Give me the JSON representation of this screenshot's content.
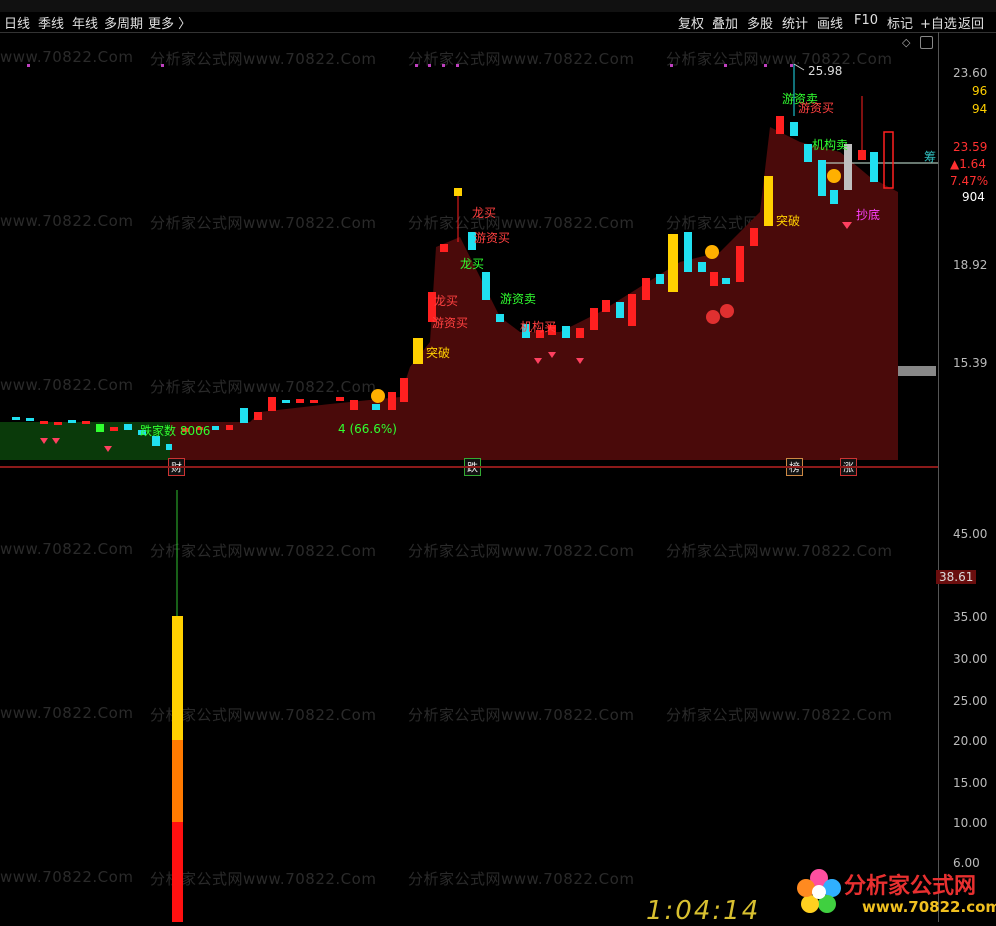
{
  "toolbar_left": [
    "日线",
    "季线",
    "年线",
    "多周期",
    "更多 〉"
  ],
  "toolbar_right": [
    "复权",
    "叠加",
    "多股",
    "统计",
    "画线",
    "F10",
    "标记",
    "+自选",
    "返回"
  ],
  "price_axis": {
    "labels": [
      "23.60",
      "96",
      "94",
      "23.59",
      "▲1.64",
      "7.47%",
      "904",
      "18.92",
      "15.39"
    ],
    "colors": {
      "neutral": "#bbbbbb",
      "up": "#ff3030",
      "vol": "#ffffff",
      "yellow": "#ffd000"
    }
  },
  "indicator_axis": {
    "labels": [
      "45.00",
      "35.00",
      "30.00",
      "25.00",
      "20.00",
      "15.00",
      "10.00",
      "6.00"
    ],
    "current": "38.61"
  },
  "annotations": {
    "peak": "25.98",
    "dragon_buy": "龙买",
    "hot_buy": "游资买",
    "hot_sell": "游资卖",
    "inst_buy": "机构买",
    "inst_sell": "机构卖",
    "breakout": "突破",
    "bottom": "抄底",
    "counter_info": "跌家数 8006",
    "pct_info": "4 (66.6%)",
    "chou": "筹"
  },
  "bottom_tags": {
    "cai": "财",
    "die": "跌",
    "bang": "榜",
    "zhang": "涨"
  },
  "watermark": {
    "text": "分析家公式网www.70822.Com",
    "short": "www.70822.Com"
  },
  "logo": {
    "name": "分析家公式网",
    "url": "www.70822.com"
  },
  "clock": "1:04:14",
  "colors": {
    "up": "#ff2020",
    "down": "#20e0f0",
    "area": "#4a0a0a",
    "green_area": "#0a3a0a",
    "yellow": "#ffd000",
    "green_text": "#30ff30",
    "red_text": "#ff4040"
  }
}
